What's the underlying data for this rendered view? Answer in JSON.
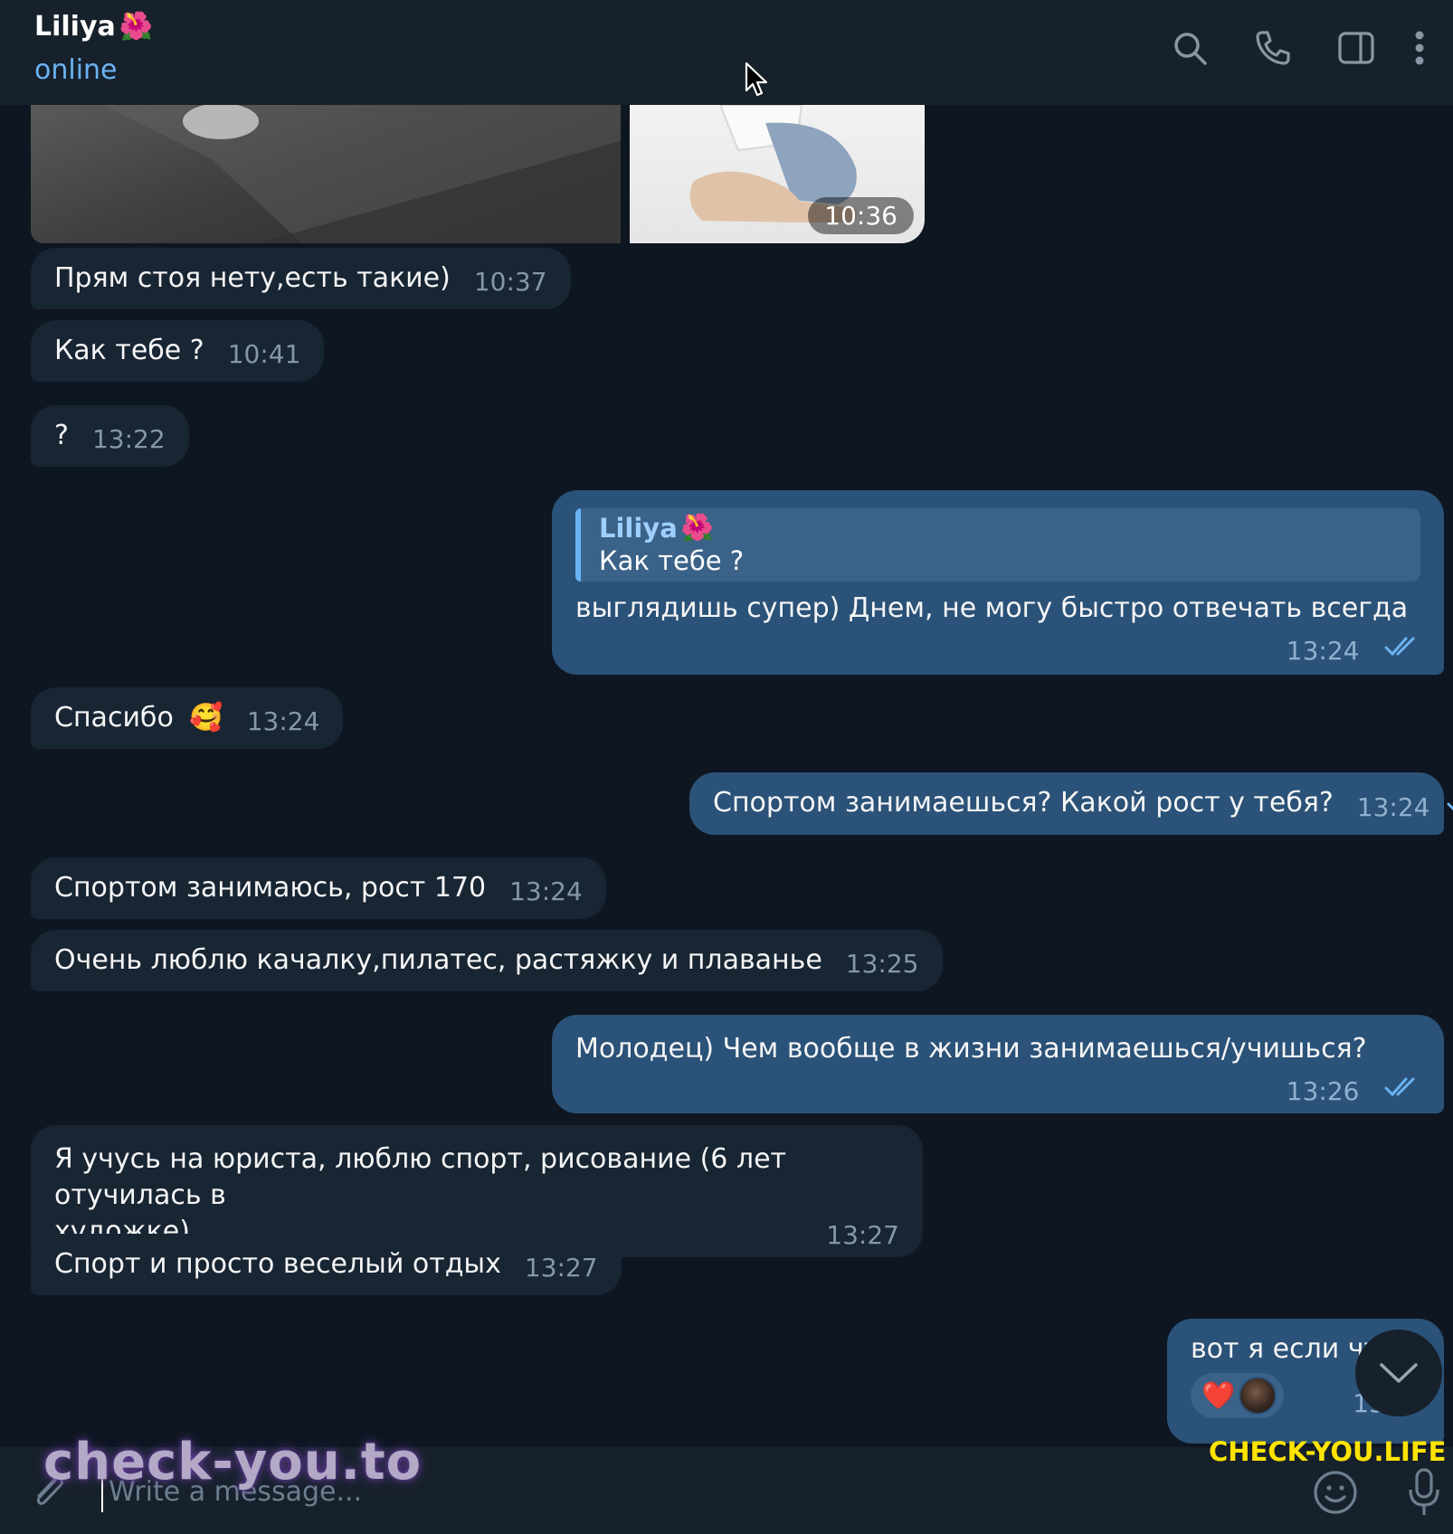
{
  "header": {
    "chat_name": "Liliya",
    "chat_name_emoji": "🌺",
    "status": "online",
    "icons": [
      "search-icon",
      "phone-icon",
      "sidebar-toggle-icon",
      "more-vertical-icon"
    ]
  },
  "media": {
    "time": "10:36"
  },
  "messages": [
    {
      "direction": "in",
      "text": "Прям стоя нету,есть такие)",
      "time": "10:37"
    },
    {
      "direction": "in",
      "text": "Как тебе ?",
      "time": "10:41"
    },
    {
      "direction": "in",
      "text": "?",
      "time": "13:22"
    },
    {
      "direction": "out",
      "reply_name": "Liliya",
      "reply_emoji": "🌺",
      "reply_text": "Как тебе ?",
      "text": "выглядишь супер) Днем, не могу быстро отвечать всегда",
      "time": "13:24"
    },
    {
      "direction": "in",
      "text": "Спасибо",
      "emoji": "🥰",
      "time": "13:24"
    },
    {
      "direction": "out",
      "text": "Спортом занимаешься? Какой рост у тебя?",
      "time": "13:24"
    },
    {
      "direction": "in",
      "text": "Спортом занимаюсь, рост 170",
      "time": "13:24"
    },
    {
      "direction": "in",
      "text": "Очень люблю качалку,пилатес, растяжку и плаванье",
      "time": "13:25"
    },
    {
      "direction": "out",
      "text": "Молодец) Чем вообще в жизни занимаешься/учишься?",
      "time": "13:26"
    },
    {
      "direction": "in",
      "text_line1": "Я учусь на юриста, люблю спорт, рисование (6 лет отучилась в",
      "text_line2": "художке)",
      "time": "13:27"
    },
    {
      "direction": "in",
      "text": "Спорт и просто веселый отдых",
      "time": "13:27"
    },
    {
      "direction": "out",
      "text": "вот я если чт",
      "reaction": "❤️",
      "time": "13:27"
    }
  ],
  "composer": {
    "placeholder": "Write a message..."
  },
  "watermarks": {
    "left": "check-you.to",
    "right": "CHECK-YOU.LIFE"
  },
  "colors": {
    "background": "#0e1621",
    "header": "#17212b",
    "incoming_bubble": "#182533",
    "outgoing_bubble": "#2b5278",
    "accent": "#6ab3f3",
    "watermark_right": "#ffe400"
  }
}
